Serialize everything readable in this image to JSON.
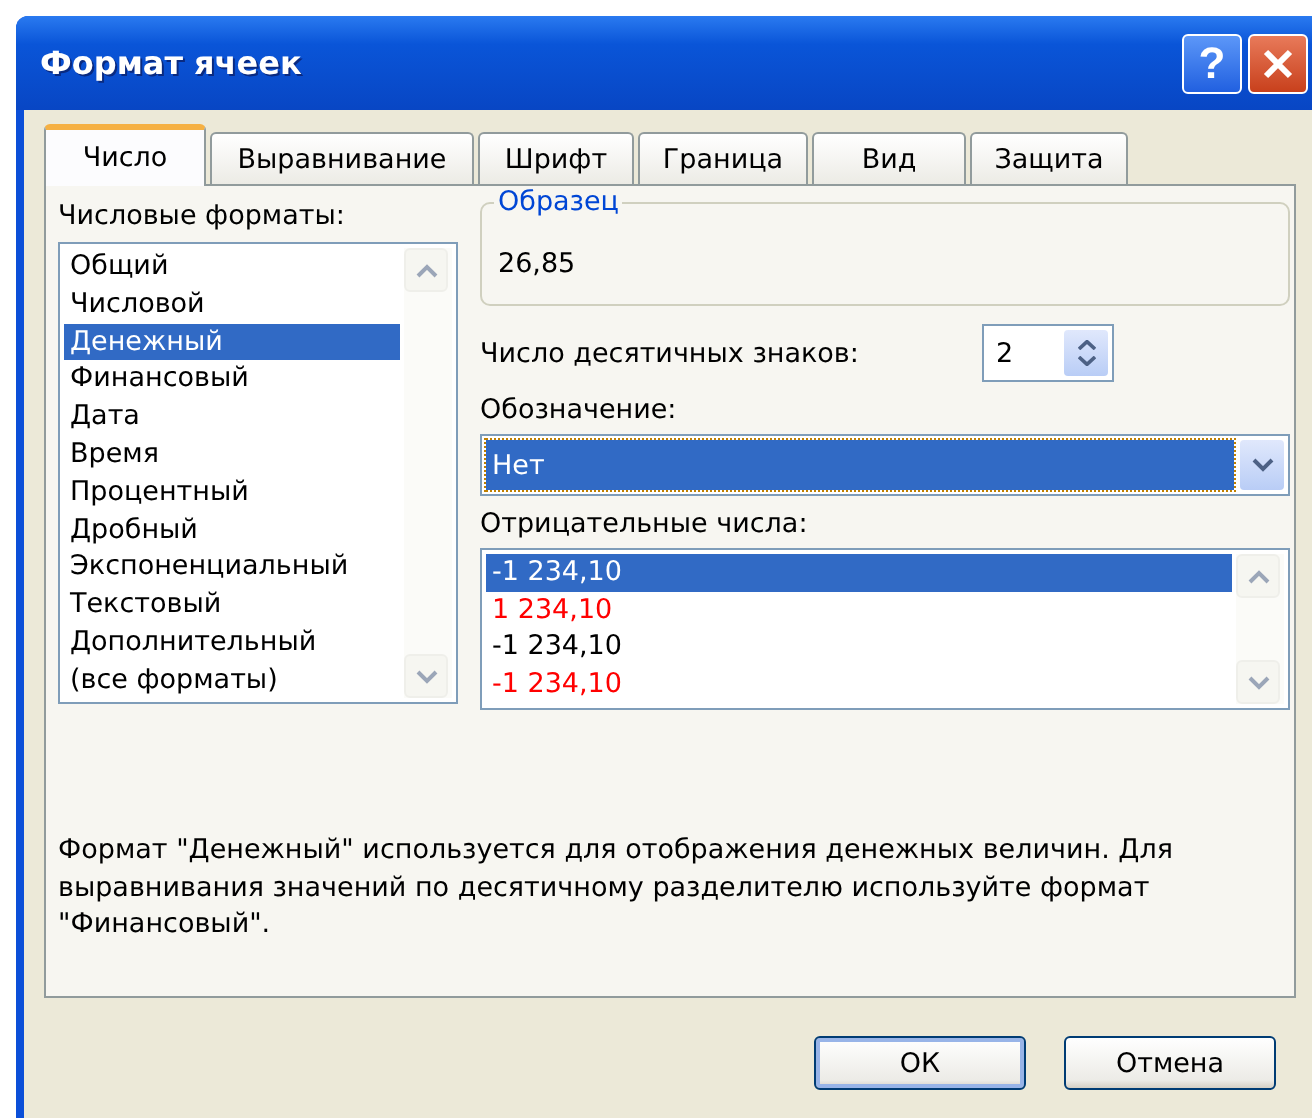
{
  "window": {
    "title": "Формат ячеек",
    "help_button": "?"
  },
  "tabs": [
    {
      "label": "Число",
      "selected": true
    },
    {
      "label": "Выравнивание",
      "selected": false
    },
    {
      "label": "Шрифт",
      "selected": false
    },
    {
      "label": "Граница",
      "selected": false
    },
    {
      "label": "Вид",
      "selected": false
    },
    {
      "label": "Защита",
      "selected": false
    }
  ],
  "number_formats": {
    "label": "Числовые форматы:",
    "items": [
      {
        "label": "Общий",
        "selected": false
      },
      {
        "label": "Числовой",
        "selected": false
      },
      {
        "label": "Денежный",
        "selected": true
      },
      {
        "label": "Финансовый",
        "selected": false
      },
      {
        "label": "Дата",
        "selected": false
      },
      {
        "label": "Время",
        "selected": false
      },
      {
        "label": "Процентный",
        "selected": false
      },
      {
        "label": "Дробный",
        "selected": false
      },
      {
        "label": "Экспоненциальный",
        "selected": false
      },
      {
        "label": "Текстовый",
        "selected": false
      },
      {
        "label": "Дополнительный",
        "selected": false
      },
      {
        "label": "(все форматы)",
        "selected": false
      }
    ]
  },
  "sample": {
    "title": "Образец",
    "value": "26,85"
  },
  "decimal_places": {
    "label": "Число десятичных знаков:",
    "value": "2"
  },
  "symbol": {
    "label": "Обозначение:",
    "value": "Нет"
  },
  "negative_numbers": {
    "label": "Отрицательные числа:",
    "items": [
      {
        "label": "-1 234,10",
        "kind": "plain",
        "selected": true
      },
      {
        "label": "1 234,10",
        "kind": "red",
        "selected": false
      },
      {
        "label": "-1 234,10",
        "kind": "plain",
        "selected": false
      },
      {
        "label": "-1 234,10",
        "kind": "red",
        "selected": false
      }
    ]
  },
  "description": "Формат \"Денежный\" используется для отображения денежных величин. Для выравнивания значений по десятичному разделителю используйте формат \"Финансовый\".",
  "buttons": [
    {
      "label": "ОК",
      "default": true
    },
    {
      "label": "Отмена",
      "default": false
    }
  ]
}
